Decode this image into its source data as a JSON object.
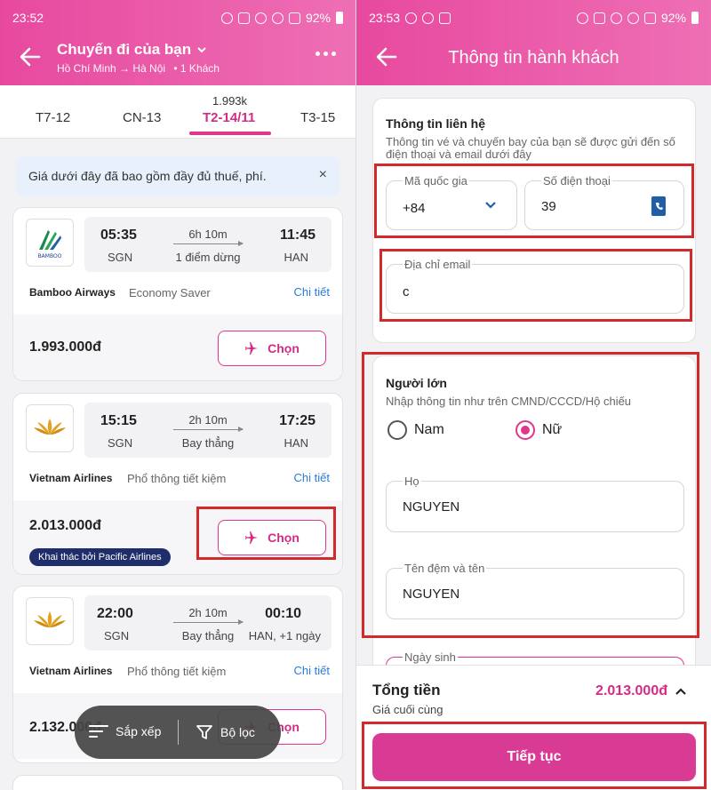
{
  "left": {
    "status": {
      "time": "23:52",
      "battery": "92%"
    },
    "header": {
      "title": "Chuyến đi của bạn",
      "route": "Hồ Chí Minh → Hà Nội",
      "passengers": "• 1 Khách"
    },
    "dates": [
      {
        "label": "T7-12"
      },
      {
        "label": "CN-13"
      },
      {
        "label": "T2-14/11",
        "price": "1.993k",
        "selected": true
      },
      {
        "label": "T3-15"
      }
    ],
    "notice": {
      "text": "Giá dưới đây đã bao gồm đầy đủ thuế, phí.",
      "close": "×"
    },
    "flights": [
      {
        "dep_time": "05:35",
        "arr_time": "11:45",
        "dep_airport": "SGN",
        "arr_airport": "HAN",
        "duration": "6h 10m",
        "stops": "1  điểm dừng",
        "airline": "Bamboo Airways",
        "fare_class": "Economy Saver",
        "detail": "Chi tiết",
        "price": "1.993.000đ",
        "choose": "Chọn",
        "logo": "BAMBOO"
      },
      {
        "dep_time": "15:15",
        "arr_time": "17:25",
        "dep_airport": "SGN",
        "arr_airport": "HAN",
        "duration": "2h 10m",
        "stops": "Bay thẳng",
        "airline": "Vietnam Airlines",
        "fare_class": "Phổ thông tiết kiệm",
        "detail": "Chi tiết",
        "price": "2.013.000đ",
        "badge": "Khai thác bởi Pacific Airlines",
        "choose": "Chọn"
      },
      {
        "dep_time": "22:00",
        "arr_time": "00:10",
        "dep_airport": "SGN",
        "arr_airport": "HAN, +1 ngày",
        "duration": "2h 10m",
        "stops": "Bay thẳng",
        "airline": "Vietnam Airlines",
        "fare_class": "Phổ thông tiết kiệm",
        "detail": "Chi tiết",
        "price": "2.132.000đ",
        "choose": "Chọn"
      }
    ],
    "sort_bar": {
      "sort": "Sắp xếp",
      "filter": "Bộ lọc"
    }
  },
  "right": {
    "status": {
      "time": "23:53",
      "battery": "92%"
    },
    "header": {
      "title": "Thông tin hành khách"
    },
    "contact": {
      "title": "Thông tin liên hệ",
      "subtitle": "Thông tin vé và chuyến bay của bạn sẽ được gửi đến số điện thoại và email dưới đây",
      "country_label": "Mã quốc gia",
      "country_value": "+84",
      "phone_label": "Số điện thoại",
      "phone_value": "39",
      "email_label": "Địa chỉ email",
      "email_value": "c"
    },
    "adult": {
      "title": "Người lớn",
      "subtitle": "Nhập thông tin như trên CMND/CCCD/Hộ chiếu",
      "gender_male": "Nam",
      "gender_female": "Nữ",
      "last_name_label": "Họ",
      "last_name_value": "NGUYEN",
      "first_name_label": "Tên đệm và tên",
      "first_name_value": "NGUYEN",
      "dob_label": "Ngày sinh"
    },
    "summary": {
      "total_label": "Tổng tiền",
      "total_sub": "Giá cuối cùng",
      "total_value": "2.013.000đ",
      "continue": "Tiếp tục"
    }
  },
  "colors": {
    "brand": "#e0368f",
    "highlight": "#d22a2a",
    "link": "#2a7bd5",
    "badge": "#1f2e6a"
  }
}
